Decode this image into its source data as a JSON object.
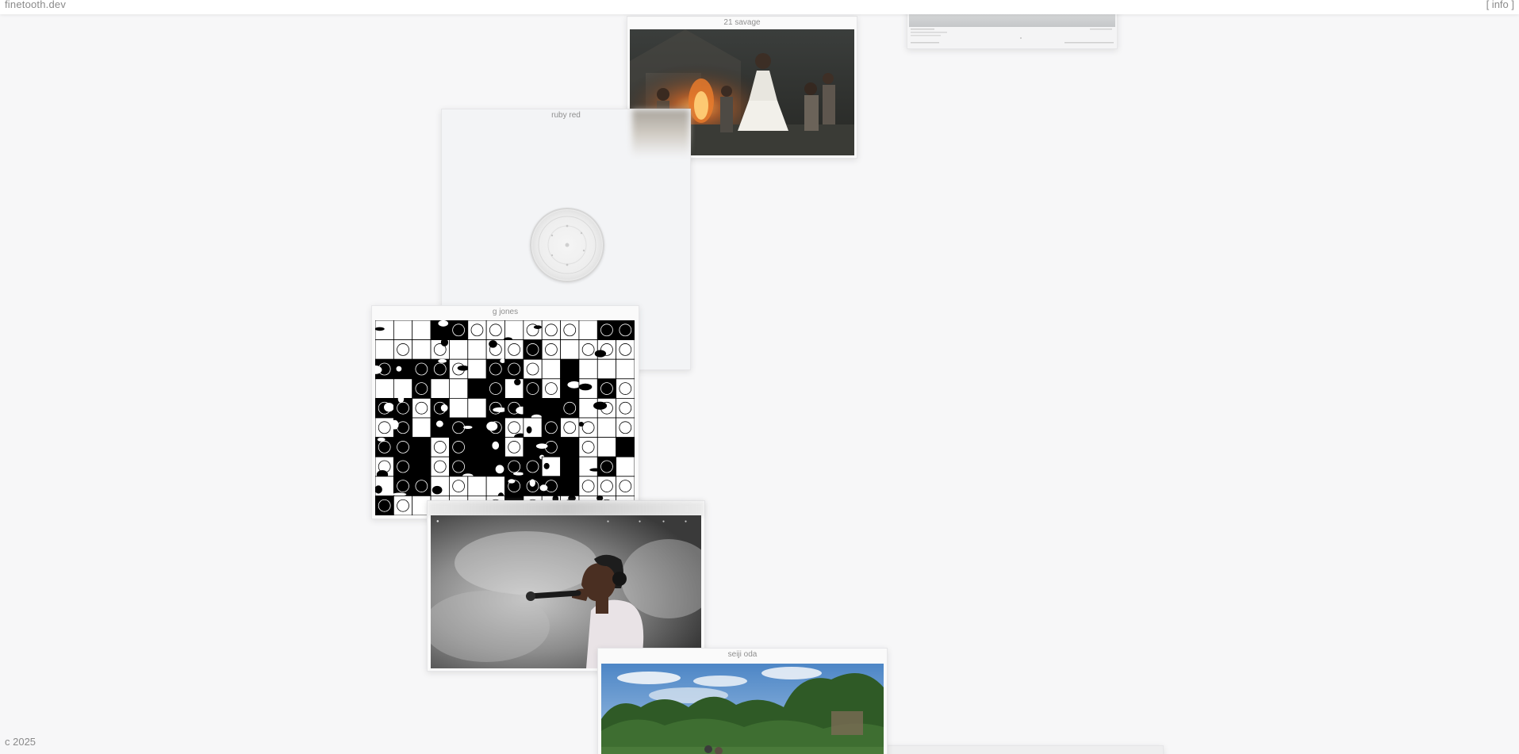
{
  "header": {
    "brand": "finetooth.dev",
    "info_link": "[ info ]"
  },
  "footer": {
    "copyright": "c 2025"
  },
  "cards": {
    "savage": {
      "title": "21 savage",
      "image": "painting-children-around-bonfire"
    },
    "ruby": {
      "title": "ruby red",
      "image": "white-vinyl-record"
    },
    "gjones": {
      "title": "g jones",
      "image": "black-white-grid-foliage-pattern"
    },
    "fesco": {
      "image": "singer-with-headphones-and-microphone"
    },
    "seiji": {
      "title": "seiji oda",
      "image": "trees-under-cloudy-sky"
    },
    "top_right": {
      "image": "website-screenshot-thumbnail"
    },
    "bottom_right": {
      "image": "partially-visible-card"
    }
  },
  "colors": {
    "background": "#f7f7f8",
    "header_bg": "#ffffff",
    "text_muted": "#8a8a8a"
  }
}
